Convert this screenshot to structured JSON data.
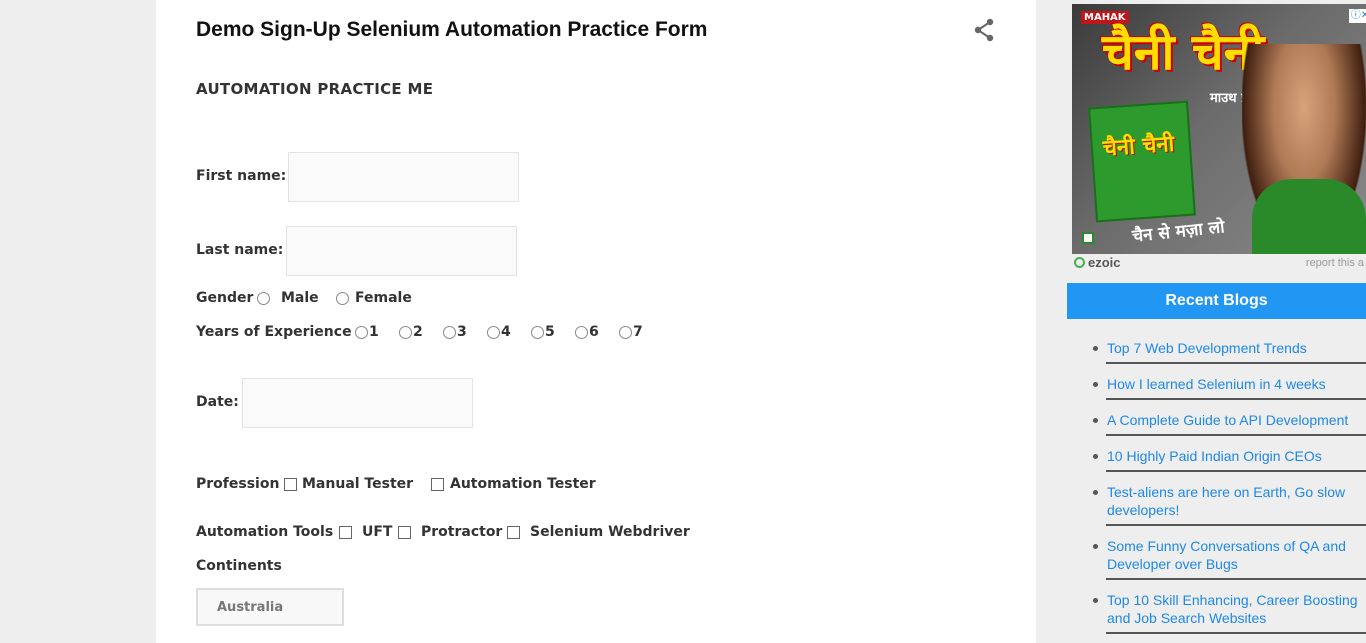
{
  "post": {
    "title": "Demo Sign-Up Selenium Automation Practice Form",
    "subtitle": "AUTOMATION PRACTICE ME"
  },
  "form": {
    "first_name_label": "First name:",
    "last_name_label": "Last name:",
    "gender_label": "Gender",
    "gender_options": [
      "Male",
      "Female"
    ],
    "experience_label": "Years of Experience",
    "experience_options": [
      "1",
      "2",
      "3",
      "4",
      "5",
      "6",
      "7"
    ],
    "date_label": "Date:",
    "profession_label": "Profession",
    "profession_options": [
      "Manual Tester",
      "Automation Tester"
    ],
    "tools_label": "Automation Tools",
    "tools_options": [
      "UFT",
      "Protractor",
      "Selenium Webdriver"
    ],
    "continents_label": "Continents",
    "continents_selected": "Australia"
  },
  "ad": {
    "brand": "MAHAK",
    "title": "चैनी चैनी",
    "subtitle": "माउथ फ्रेशनर",
    "pack_text": "चैनी चैनी",
    "tagline": "चैन से मज़ा लो",
    "network": "ezoic",
    "report": "report this a",
    "adchoices": "ⓘ✕"
  },
  "sidebar": {
    "recent_title": "Recent Blogs",
    "blogs": [
      "Top 7 Web Development Trends",
      "How I learned Selenium in 4 weeks",
      "A Complete Guide to API Development",
      "10 Highly Paid Indian Origin CEOs",
      "Test-aliens are here on Earth, Go slow developers!",
      "Some Funny Conversations of QA and Developer over Bugs",
      "Top 10 Skill Enhancing, Career Boosting and Job Search Websites"
    ]
  },
  "colors": {
    "accent": "#2196f3",
    "link": "#1e88e5"
  }
}
